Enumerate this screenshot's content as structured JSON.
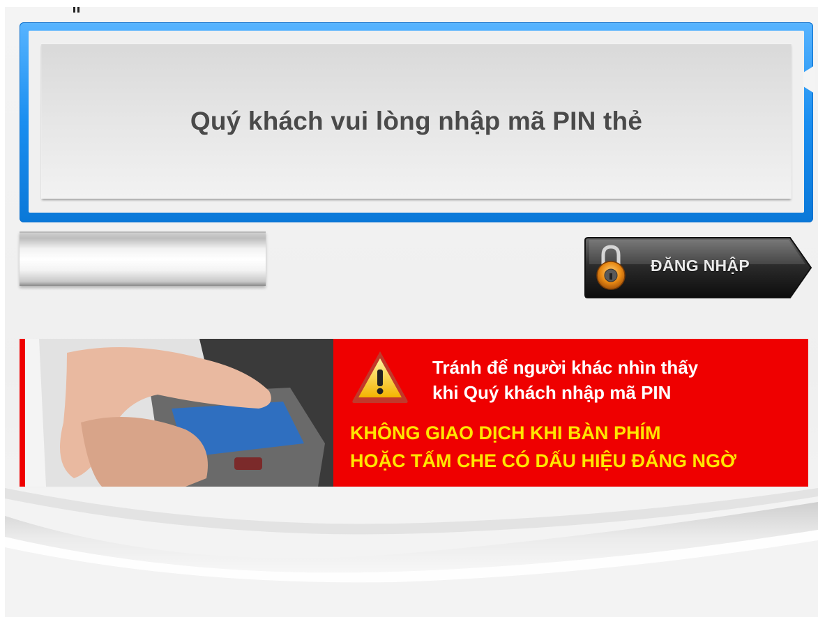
{
  "prompt": {
    "message": "Quý khách vui lòng nhập mã PIN thẻ"
  },
  "pin_field": {
    "value": ""
  },
  "login_button": {
    "label": "ĐĂNG NHẬP",
    "icon": "padlock-icon"
  },
  "warning_banner": {
    "icon": "warning-triangle-icon",
    "notice_line_1": "Tránh để người khác nhìn thấy",
    "notice_line_2": "khi Quý khách nhập mã PIN",
    "alert_line_1": "KHÔNG GIAO DỊCH KHI BÀN PHÍM",
    "alert_line_2": "HOẶC TẤM CHE CÓ DẤU HIỆU ĐÁNG NGỜ"
  },
  "colors": {
    "frame_blue": "#1a8ef0",
    "banner_red": "#ef0000",
    "alert_yellow": "#ffe600"
  }
}
